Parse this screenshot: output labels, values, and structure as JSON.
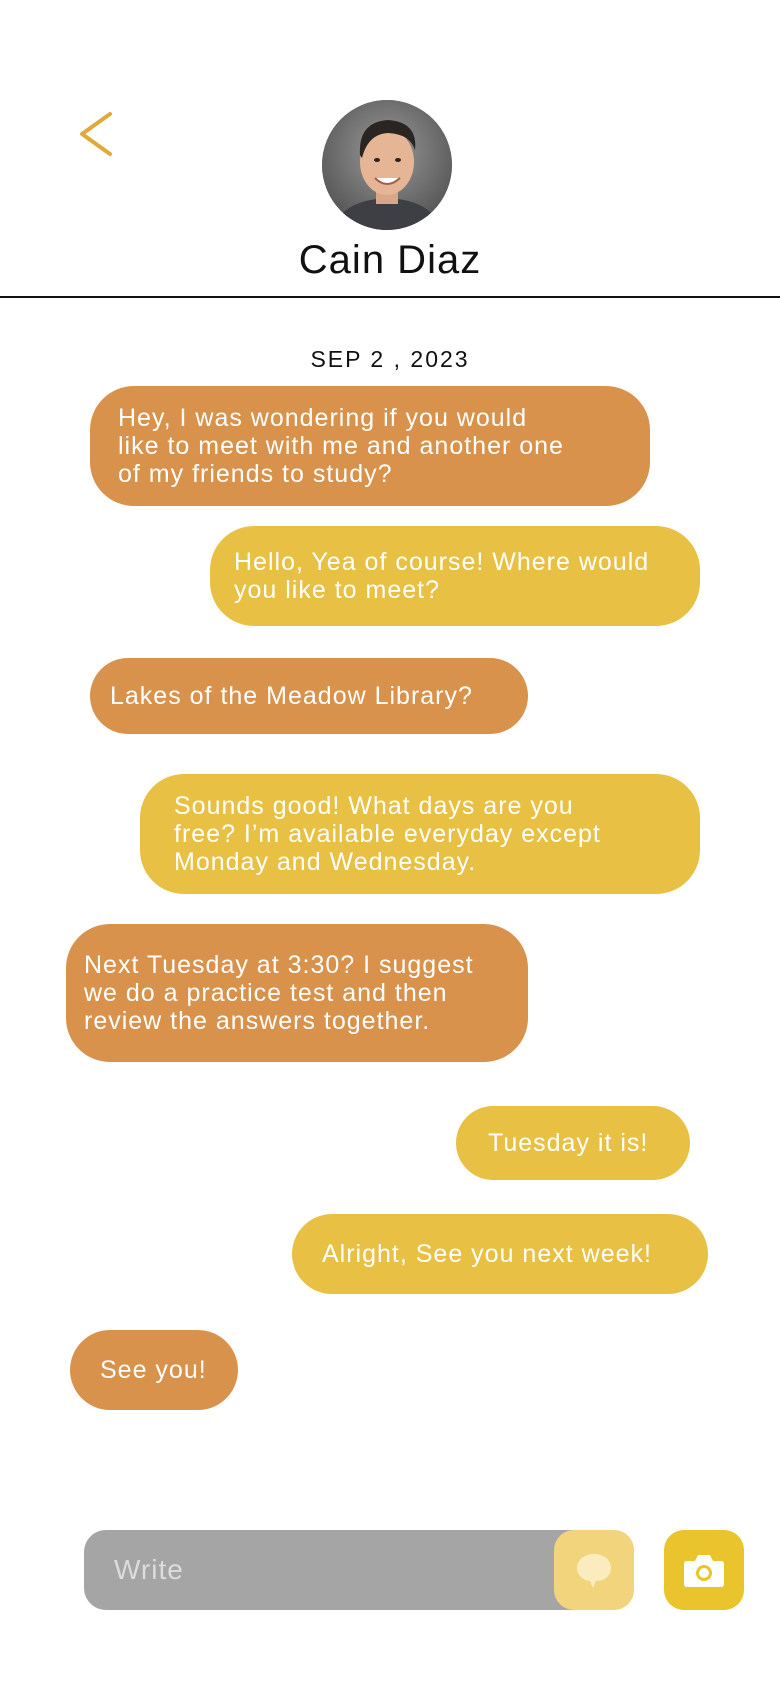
{
  "header": {
    "contact_name": "Cain Diaz",
    "back_icon": "chevron-left-icon",
    "accent_color": "#e0a93a"
  },
  "conversation": {
    "date_label": "SEP 2 , 2023",
    "messages": [
      {
        "direction": "received",
        "text": "Hey, I was wondering if you would\nlike to meet with me and another one\nof my friends to study?"
      },
      {
        "direction": "sent",
        "text": "Hello, Yea of course! Where would\nyou like to meet?"
      },
      {
        "direction": "received",
        "text": "Lakes of the Meadow Library?"
      },
      {
        "direction": "sent",
        "text": "Sounds good! What days are you\nfree? I’m available everyday except\nMonday and Wednesday."
      },
      {
        "direction": "received",
        "text": "Next Tuesday at 3:30? I suggest\nwe do a practice test and then\nreview the answers together."
      },
      {
        "direction": "sent",
        "text": "Tuesday it is!"
      },
      {
        "direction": "sent",
        "text": "Alright, See you next week!"
      },
      {
        "direction": "received",
        "text": "See you!"
      }
    ]
  },
  "colors": {
    "received_bubble": "#d8924b",
    "sent_bubble": "#e8c043",
    "composer_bg": "#a5a5a5",
    "emoji_button": "#f2d47d",
    "camera_button": "#e9c42c"
  },
  "composer": {
    "placeholder": "Write",
    "emoji_icon": "speech-bubble-icon",
    "camera_icon": "camera-icon"
  }
}
